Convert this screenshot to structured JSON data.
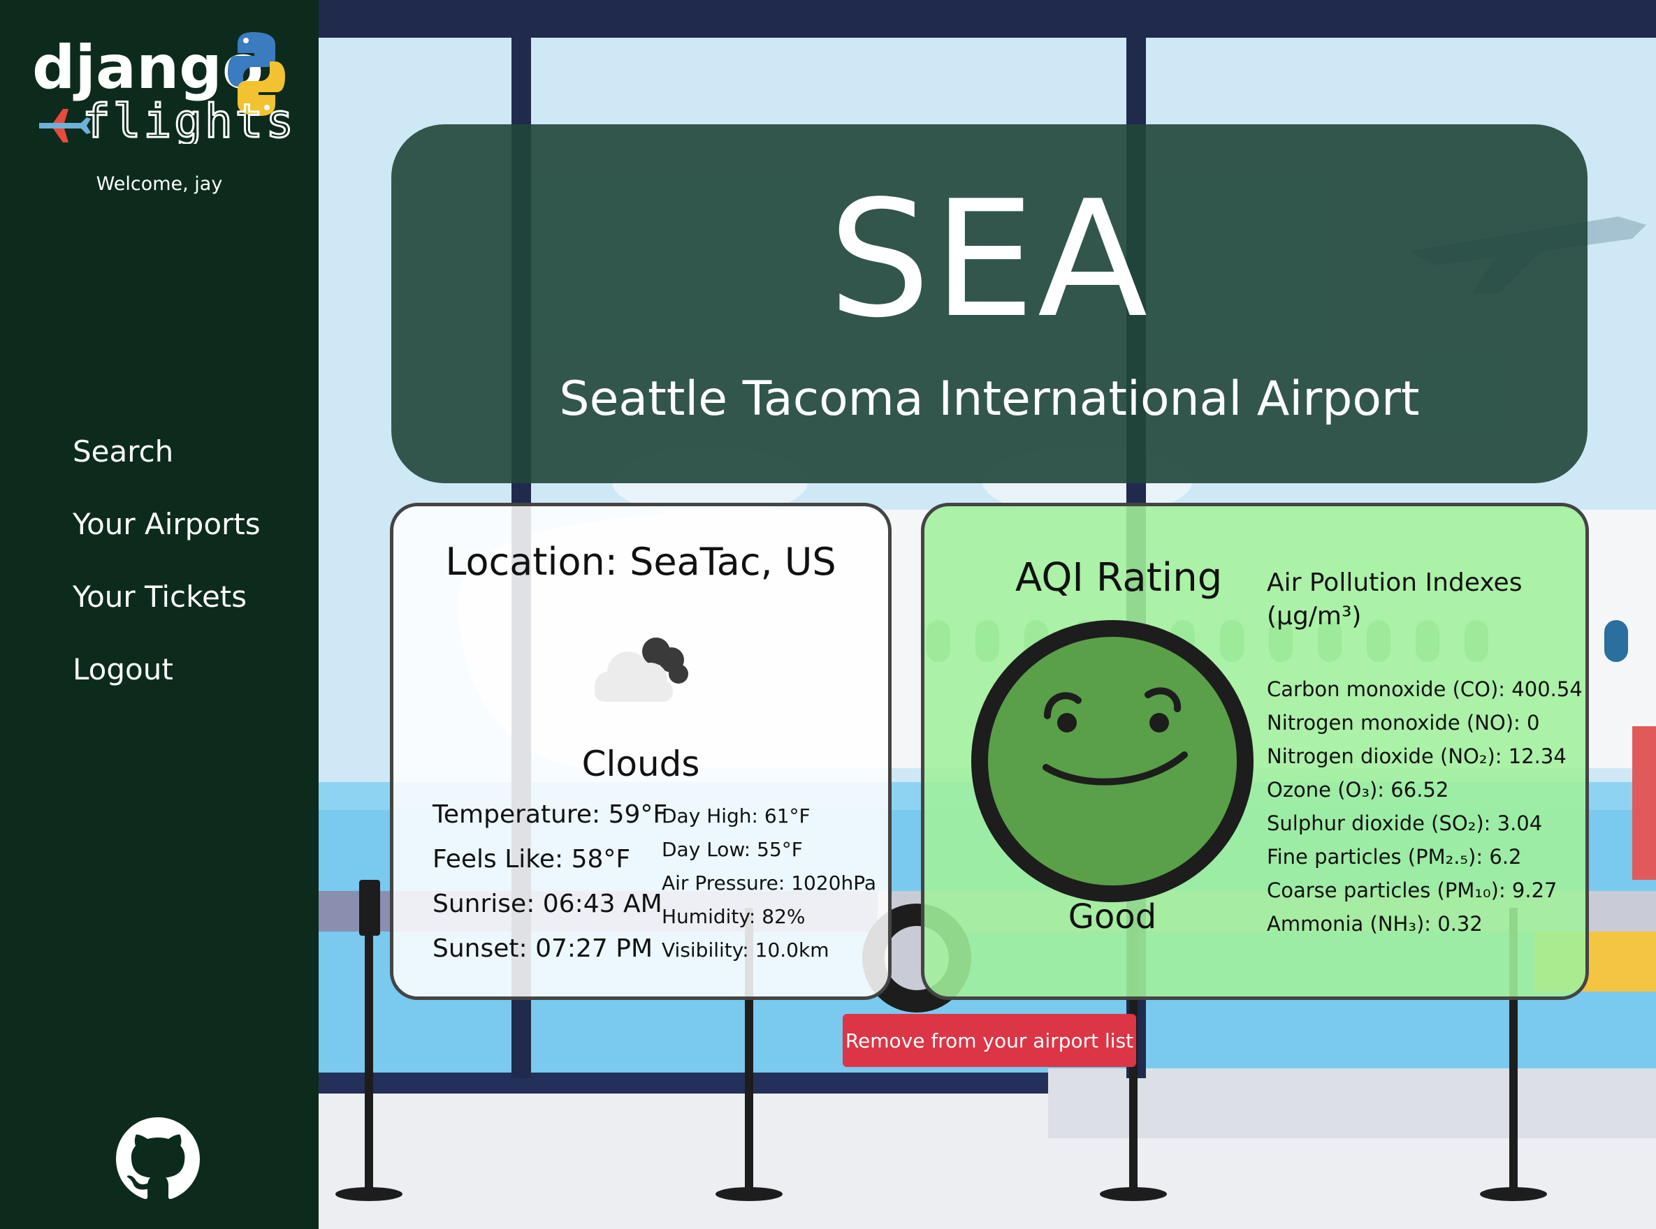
{
  "sidebar": {
    "logo_text_top": "django",
    "logo_text_bottom": "flights",
    "welcome": "Welcome, jay",
    "nav": [
      {
        "label": "Search"
      },
      {
        "label": "Your Airports"
      },
      {
        "label": "Your Tickets"
      },
      {
        "label": "Logout"
      }
    ],
    "footer_icon": "github-icon"
  },
  "airport": {
    "code": "SEA",
    "name": "Seattle Tacoma International Airport"
  },
  "weather": {
    "location": "Location: SeaTac, US",
    "icon": "cloud-icon",
    "condition": "Clouds",
    "temperature": "Temperature: 59°F",
    "feels_like": "Feels Like: 58°F",
    "sunrise": "Sunrise: 06:43 AM",
    "sunset": "Sunset: 07:27 PM",
    "day_high": "Day High: 61°F",
    "day_low": "Day Low: 55°F",
    "pressure": "Air Pressure: 1020hPa",
    "humidity": "Humidity: 82%",
    "visibility": "Visibility: 10.0km"
  },
  "aqi": {
    "title": "AQI Rating",
    "rating": "Good",
    "face_icon": "smiley-face-icon",
    "pollution_title": "Air Pollution Indexes",
    "pollution_unit": "(μg/m³)",
    "pollutants": [
      {
        "label": "Carbon monoxide (CO): 400.54"
      },
      {
        "label": "Nitrogen monoxide (NO): 0"
      },
      {
        "label": "Nitrogen dioxide (NO₂): 12.34"
      },
      {
        "label": "Ozone (O₃): 66.52"
      },
      {
        "label": "Sulphur dioxide (SO₂): 3.04"
      },
      {
        "label": "Fine particles (PM₂.₅): 6.2"
      },
      {
        "label": "Coarse particles (PM₁₀): 9.27"
      },
      {
        "label": "Ammonia (NH₃): 0.32"
      }
    ]
  },
  "actions": {
    "remove_label": "Remove from your airport list"
  },
  "colors": {
    "sidebar": "#0c2b1c",
    "hero": "#20463a",
    "aqi_card": "#a0f09b",
    "remove_button": "#dc3545",
    "face": "#5aa048"
  }
}
